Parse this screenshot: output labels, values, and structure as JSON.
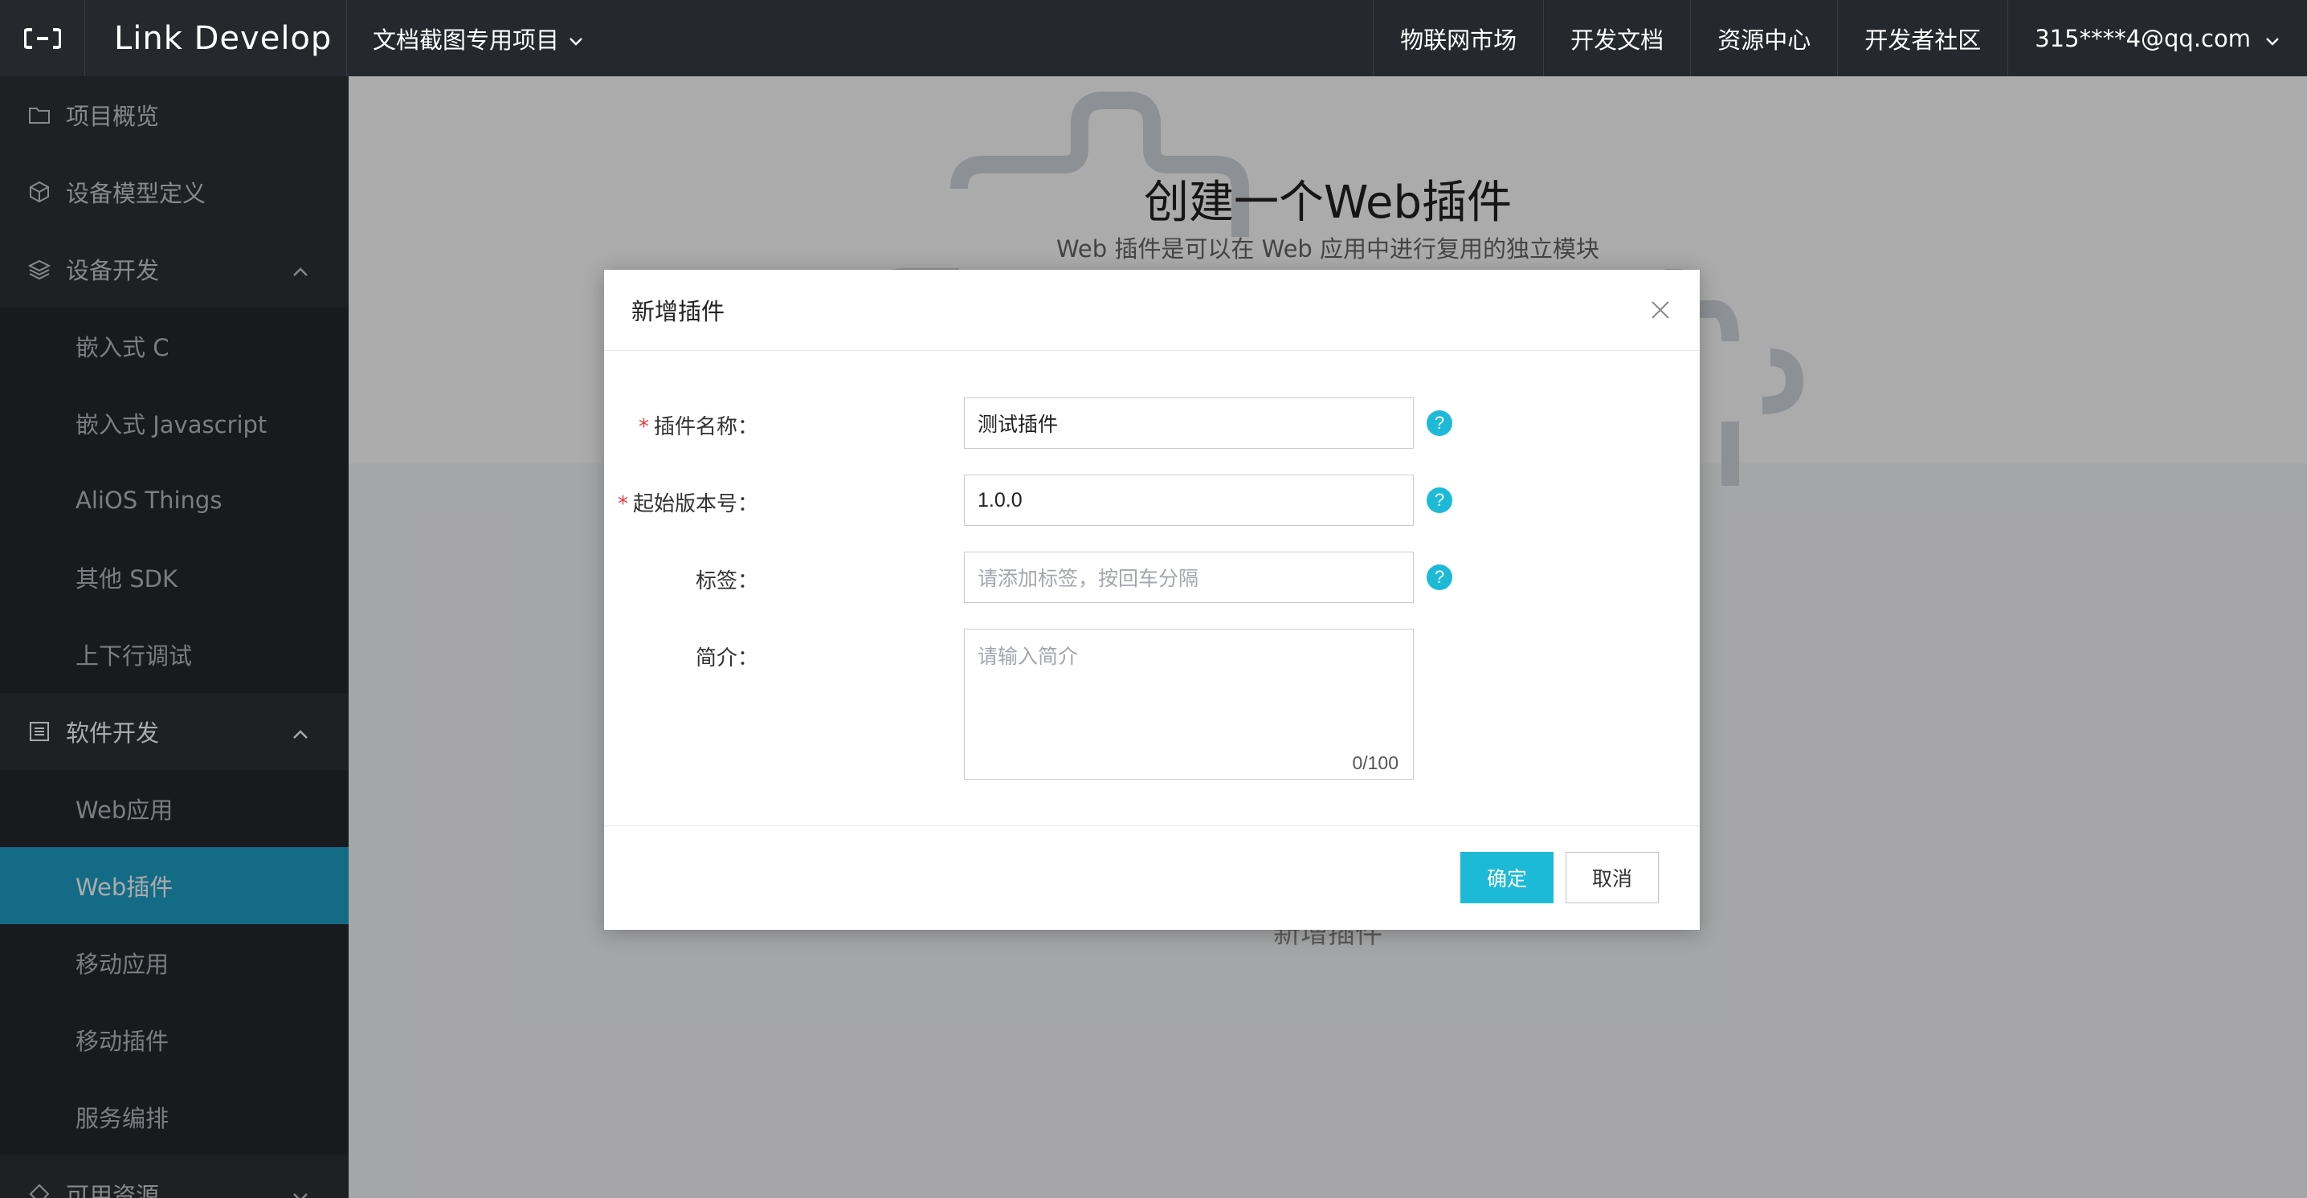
{
  "topbar": {
    "logo_icon": "link-develop-logo",
    "brand": "Link Develop",
    "project": "文档截图专用项目",
    "links": [
      "物联网市场",
      "开发文档",
      "资源中心",
      "开发者社区"
    ],
    "user": "315****4@qq.com"
  },
  "sidebar": {
    "items": [
      {
        "label": "项目概览",
        "icon": "folder-icon"
      },
      {
        "label": "设备模型定义",
        "icon": "cube-icon"
      },
      {
        "label": "设备开发",
        "icon": "layers-icon"
      },
      {
        "label": "嵌入式 C"
      },
      {
        "label": "嵌入式 Javascript"
      },
      {
        "label": "AliOS Things"
      },
      {
        "label": "其他 SDK"
      },
      {
        "label": "上下行调试"
      },
      {
        "label": "软件开发",
        "icon": "list-icon"
      },
      {
        "label": "Web应用"
      },
      {
        "label": "Web插件"
      },
      {
        "label": "移动应用"
      },
      {
        "label": "移动插件"
      },
      {
        "label": "服务编排"
      },
      {
        "label": "可用资源",
        "icon": "resource-icon"
      }
    ]
  },
  "main": {
    "hero_title": "创建一个Web插件",
    "hero_subtitle": "Web 插件是可以在 Web 应用中进行复用的独立模块",
    "empty_action": "新增插件"
  },
  "modal": {
    "title": "新增插件",
    "fields": {
      "name_label": "插件名称：",
      "name_value": "测试插件",
      "version_label": "起始版本号：",
      "version_value": "1.0.0",
      "tags_label": "标签：",
      "tags_placeholder": "请添加标签，按回车分隔",
      "intro_label": "简介：",
      "intro_placeholder": "请输入简介",
      "intro_counter": "0/100",
      "required_mark": "*",
      "help_mark": "?"
    },
    "confirm": "确定",
    "cancel": "取消"
  },
  "colors": {
    "accent": "#1dbad7",
    "sidebar_active": "#1fa0c7",
    "topbar": "#25282d",
    "required": "#e4393c"
  }
}
